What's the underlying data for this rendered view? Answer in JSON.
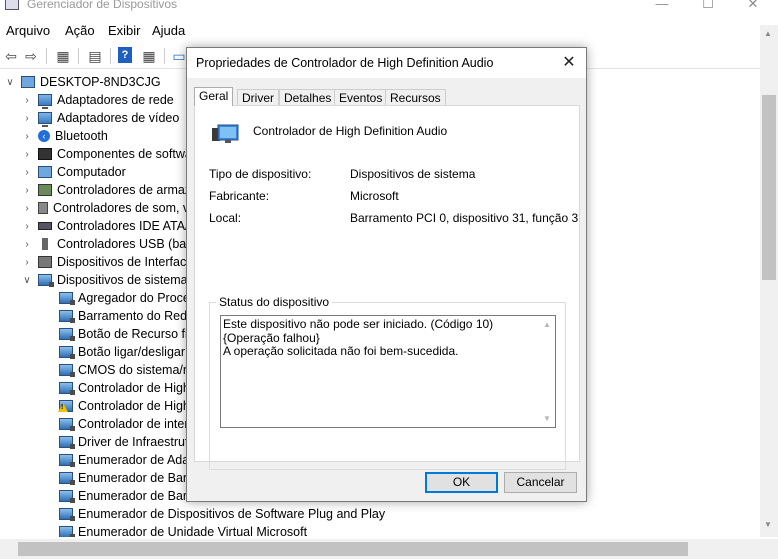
{
  "window": {
    "title": "Gerenciador de Dispositivos",
    "controls": {
      "minimize": "—",
      "maximize": "☐",
      "close": "✕"
    }
  },
  "menubar": [
    "Arquivo",
    "Ação",
    "Exibir",
    "Ajuda"
  ],
  "toolbar": {
    "icons": [
      "back-arrow-icon",
      "forward-arrow-icon",
      "properties-grid-icon",
      "document-icon",
      "help-icon",
      "details-grid-icon",
      "monitor-icon"
    ]
  },
  "tree": {
    "root": "DESKTOP-8ND3CJG",
    "categories": [
      {
        "label": "Adaptadores de rede",
        "icon": "network-adapter-icon"
      },
      {
        "label": "Adaptadores de vídeo",
        "icon": "display-adapter-icon"
      },
      {
        "label": "Bluetooth",
        "icon": "bluetooth-icon"
      },
      {
        "label": "Componentes de softwa",
        "icon": "software-component-icon"
      },
      {
        "label": "Computador",
        "icon": "computer-icon"
      },
      {
        "label": "Controladores de armaz",
        "icon": "storage-controller-icon"
      },
      {
        "label": "Controladores de som, v",
        "icon": "sound-controller-icon"
      },
      {
        "label": "Controladores IDE ATA/A",
        "icon": "ide-controller-icon"
      },
      {
        "label": "Controladores USB (barr",
        "icon": "usb-icon"
      },
      {
        "label": "Dispositivos de Interface",
        "icon": "hid-icon"
      },
      {
        "label": "Dispositivos de sistema",
        "icon": "system-device-icon"
      }
    ],
    "system_devices": [
      {
        "label": "Agregador do Proce",
        "warning": false
      },
      {
        "label": "Barramento do Redi",
        "warning": false
      },
      {
        "label": "Botão de Recurso fix",
        "warning": false
      },
      {
        "label": "Botão ligar/desligar",
        "warning": false
      },
      {
        "label": "CMOS do sistema/re",
        "warning": false
      },
      {
        "label": "Controlador de High",
        "warning": false
      },
      {
        "label": "Controlador de High",
        "warning": true
      },
      {
        "label": "Controlador de inter",
        "warning": false
      },
      {
        "label": "Driver de Infraestrutu",
        "warning": false
      },
      {
        "label": "Enumerador de Adap",
        "warning": false
      },
      {
        "label": "Enumerador de Barra",
        "warning": false
      },
      {
        "label": "Enumerador de Barr",
        "warning": false
      },
      {
        "label": "Enumerador de Dispositivos de Software Plug and Play",
        "warning": false
      },
      {
        "label": "Enumerador de Unidade Virtual Microsoft",
        "warning": false
      }
    ]
  },
  "dialog": {
    "title": "Propriedades de Controlador de High Definition Audio",
    "close": "✕",
    "tabs": [
      "Geral",
      "Driver",
      "Detalhes",
      "Eventos",
      "Recursos"
    ],
    "active_tab": "Geral",
    "device_name": "Controlador de High Definition Audio",
    "properties": [
      {
        "label": "Tipo de dispositivo:",
        "value": "Dispositivos de sistema"
      },
      {
        "label": "Fabricante:",
        "value": "Microsoft"
      },
      {
        "label": "Local:",
        "value": "Barramento PCI 0, dispositivo 31, função 3"
      }
    ],
    "status_group_label": "Status do dispositivo",
    "status_lines": [
      "Este dispositivo não pode ser iniciado. (Código 10)",
      "",
      "{Operação falhou}",
      "A operação solicitada não foi bem-sucedida."
    ],
    "buttons": {
      "ok": "OK",
      "cancel": "Cancelar"
    }
  },
  "colors": {
    "focus_border": "#0078d7",
    "warning": "#f2c200",
    "dialog_bg": "#f0f0f0"
  }
}
